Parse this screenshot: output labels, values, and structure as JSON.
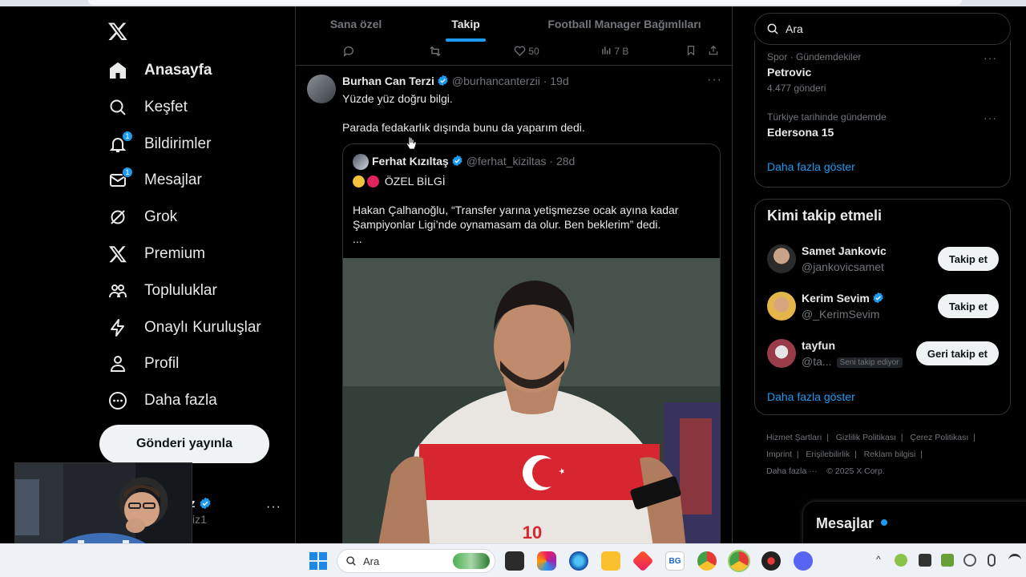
{
  "nav": {
    "items": [
      {
        "label": "Anasayfa",
        "icon": "home-icon",
        "active": true
      },
      {
        "label": "Keşfet",
        "icon": "search-icon"
      },
      {
        "label": "Bildirimler",
        "icon": "bell-icon",
        "badge": "1"
      },
      {
        "label": "Mesajlar",
        "icon": "mail-icon",
        "badge": "1"
      },
      {
        "label": "Grok",
        "icon": "grok-icon"
      },
      {
        "label": "Premium",
        "icon": "x-icon"
      },
      {
        "label": "Topluluklar",
        "icon": "people-icon"
      },
      {
        "label": "Onaylı Kuruluşlar",
        "icon": "lightning-icon"
      },
      {
        "label": "Profil",
        "icon": "person-icon"
      },
      {
        "label": "Daha fazla",
        "icon": "more-circle-icon"
      }
    ],
    "post_button": "Gönderi yayınla",
    "account_fragment_name": "z",
    "account_fragment_handle": "iz1",
    "account_more": "···"
  },
  "tabs": [
    "Sana özel",
    "Takip",
    "Football Manager Bağımlıları"
  ],
  "action_row": {
    "likes": "50",
    "views": "7 B"
  },
  "tweet": {
    "name": "Burhan Can Terzi",
    "handle": "@burhancanterzii",
    "time": "· 19d",
    "line1": "Yüzde yüz doğru bilgi.",
    "line2": "Parada fedakarlık dışında bunu da yaparım dedi.",
    "more": "···",
    "quote": {
      "name": "Ferhat Kızıltaş",
      "handle": "@ferhat_kiziltas",
      "time": "· 28d",
      "headline": "ÖZEL BİLGİ",
      "line1": "Hakan Çalhanoğlu, “Transfer yarına yetişmezse ocak ayına kadar",
      "line2": "Şampiyonlar Ligi’nde oynamasam da olur. Ben beklerim” dedi.",
      "line3": "...",
      "jersey_number": "10"
    }
  },
  "search": {
    "placeholder": "Ara"
  },
  "trends": [
    {
      "category": "Spor · Gündemdekiler",
      "name": "Petrovic",
      "count": "4.477 gönderi"
    },
    {
      "category": "Türkiye tarihinde gündemde",
      "name": "Edersona 15",
      "count": ""
    }
  ],
  "trends_more": "Daha fazla göster",
  "who_to_follow": {
    "title": "Kimi takip etmeli",
    "users": [
      {
        "name": "Samet Jankovic",
        "handle": "@jankovicsamet",
        "button": "Takip et",
        "verified": false
      },
      {
        "name": "Kerim Sevim",
        "handle": "@_KerimSevim",
        "button": "Takip et",
        "verified": true
      },
      {
        "name": "tayfun",
        "handle": "@ta...",
        "button": "Geri takip et",
        "follows_you": "Seni takip ediyor"
      }
    ],
    "more": "Daha fazla göster"
  },
  "footer": {
    "links": [
      "Hizmet Şartları",
      "Gizlilik Politikası",
      "Çerez Politikası",
      "Imprint",
      "Erişilebilirlik",
      "Reklam bilgisi",
      "Daha fazla ···"
    ],
    "copyright": "© 2025 X Corp."
  },
  "messages_bar": {
    "title": "Mesajlar"
  },
  "taskbar": {
    "search_placeholder": "Ara"
  },
  "colors": {
    "accent": "#1d9bf0",
    "background": "#000000",
    "text": "#e7e9ea",
    "muted": "#71767b",
    "border": "#2f3336"
  }
}
